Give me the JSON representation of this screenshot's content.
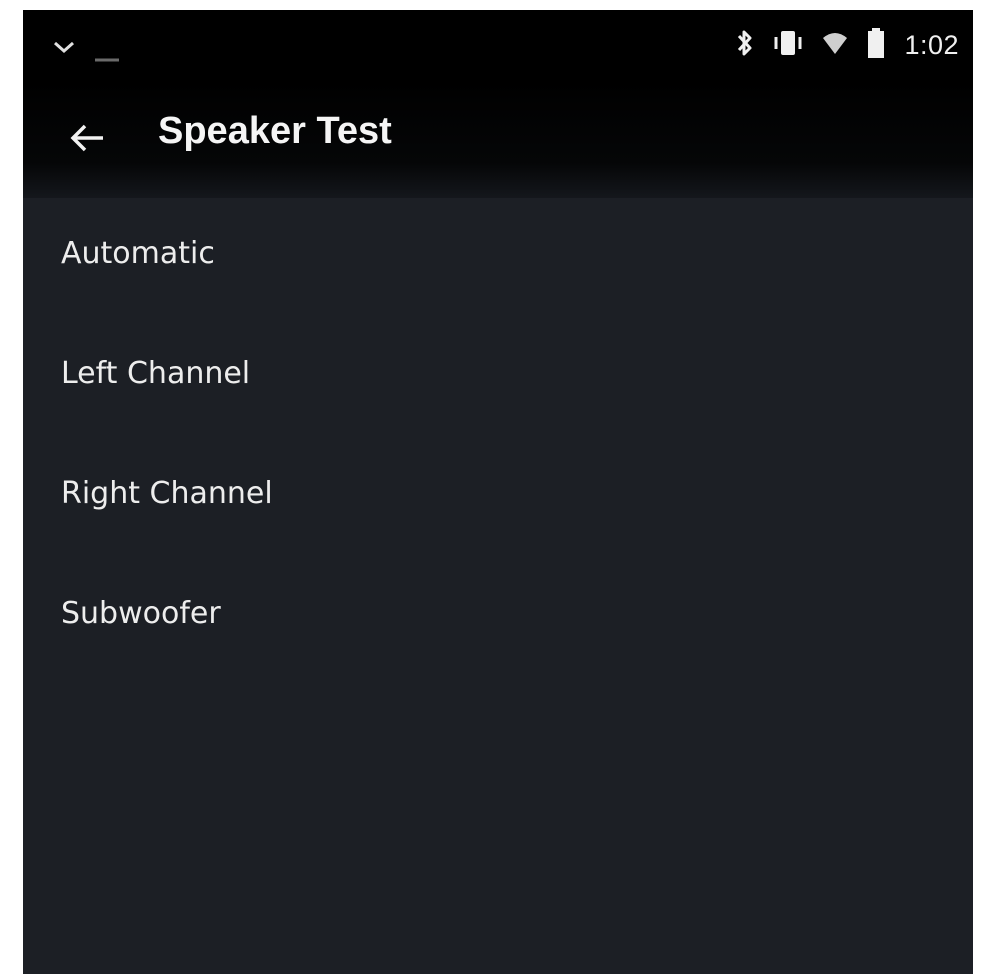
{
  "status_bar": {
    "time": "1:02",
    "icons": [
      "notification-chevron-icon",
      "bluetooth-icon",
      "vibrate-icon",
      "wifi-icon",
      "battery-icon"
    ]
  },
  "app_bar": {
    "back_icon": "arrow-left-icon",
    "title": "Speaker Test"
  },
  "menu": {
    "items": [
      {
        "label": "Automatic"
      },
      {
        "label": "Left Channel"
      },
      {
        "label": "Right Channel"
      },
      {
        "label": "Subwoofer"
      }
    ]
  },
  "colors": {
    "background": "#1c1f25",
    "bars": "#000000",
    "text": "#ededed"
  }
}
